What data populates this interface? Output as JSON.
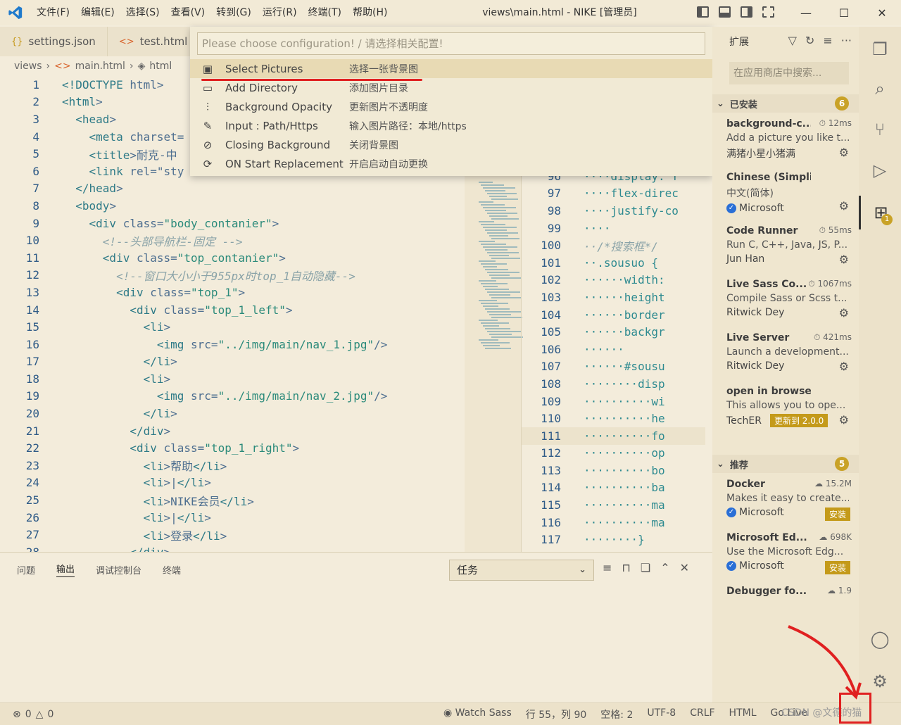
{
  "titlebar": {
    "menu": [
      "文件(F)",
      "编辑(E)",
      "选择(S)",
      "查看(V)",
      "转到(G)",
      "运行(R)",
      "终端(T)",
      "帮助(H)"
    ],
    "title": "views\\main.html - NIKE [管理员]",
    "controls": [
      "—",
      "☐",
      "✕"
    ]
  },
  "tabs": [
    {
      "icon": "{}",
      "label": "settings.json"
    },
    {
      "icon": "<>",
      "label": "test.html"
    }
  ],
  "breadcrumb": [
    "views",
    "main.html",
    "html"
  ],
  "quickpick": {
    "placeholder": "Please choose configuration! / 请选择相关配置!",
    "items": [
      {
        "label": "Select Pictures",
        "desc": "选择一张背景图",
        "icon": "image-icon"
      },
      {
        "label": "Add Directory",
        "desc": "添加图片目录",
        "icon": "folder-icon"
      },
      {
        "label": "Background Opacity",
        "desc": "更新图片不透明度",
        "icon": "sliders-icon"
      },
      {
        "label": "Input : Path/Https",
        "desc": "输入图片路径：本地/https",
        "icon": "pencil-icon"
      },
      {
        "label": "Closing Background",
        "desc": "关闭背景图",
        "icon": "eye-off-icon"
      },
      {
        "label": "ON Start Replacement",
        "desc": "开启启动自动更换",
        "icon": "refresh-icon"
      }
    ]
  },
  "editor_lines": [
    {
      "n": "1",
      "code": "<!DOCTYPE html>"
    },
    {
      "n": "2",
      "code": "<html>"
    },
    {
      "n": "3",
      "code": "  <head>"
    },
    {
      "n": "4",
      "code": "    <meta charset="
    },
    {
      "n": "5",
      "code": "    <title>耐克-中"
    },
    {
      "n": "6",
      "code": "    <link rel=\"sty"
    },
    {
      "n": "7",
      "code": "  </head>"
    },
    {
      "n": "8",
      "code": "  <body>"
    },
    {
      "n": "9",
      "code": "    <div class=\"body_contanier\">"
    },
    {
      "n": "10",
      "code": "      <!--头部导航栏-固定 -->"
    },
    {
      "n": "11",
      "code": "      <div class=\"top_contanier\">"
    },
    {
      "n": "12",
      "code": "        <!--窗口大小小于955px时top_1自动隐藏-->"
    },
    {
      "n": "13",
      "code": "        <div class=\"top_1\">"
    },
    {
      "n": "14",
      "code": "          <div class=\"top_1_left\">"
    },
    {
      "n": "15",
      "code": "            <li>"
    },
    {
      "n": "16",
      "code": "              <img src=\"../img/main/nav_1.jpg\"/>"
    },
    {
      "n": "17",
      "code": "            </li>"
    },
    {
      "n": "18",
      "code": "            <li>"
    },
    {
      "n": "19",
      "code": "              <img src=\"../img/main/nav_2.jpg\"/>"
    },
    {
      "n": "20",
      "code": "            </li>"
    },
    {
      "n": "21",
      "code": "          </div>"
    },
    {
      "n": "22",
      "code": "          <div class=\"top_1_right\">"
    },
    {
      "n": "23",
      "code": "            <li>帮助</li>"
    },
    {
      "n": "24",
      "code": "            <li>|</li>"
    },
    {
      "n": "25",
      "code": "            <li>NIKE会员</li>"
    },
    {
      "n": "26",
      "code": "            <li>|</li>"
    },
    {
      "n": "27",
      "code": "            <li>登录</li>"
    },
    {
      "n": "28",
      "code": "          </div>"
    }
  ],
  "editor2_lines": [
    {
      "n": "96",
      "code": "····display: f"
    },
    {
      "n": "97",
      "code": "····flex-direc"
    },
    {
      "n": "98",
      "code": "····justify-co"
    },
    {
      "n": "99",
      "code": "····"
    },
    {
      "n": "100",
      "code": "··/*搜索框*/"
    },
    {
      "n": "101",
      "code": "··.sousuo {"
    },
    {
      "n": "102",
      "code": "······width:"
    },
    {
      "n": "103",
      "code": "······height"
    },
    {
      "n": "104",
      "code": "······border"
    },
    {
      "n": "105",
      "code": "······backgr"
    },
    {
      "n": "106",
      "code": "······"
    },
    {
      "n": "107",
      "code": "······#sousu"
    },
    {
      "n": "108",
      "code": "········disp"
    },
    {
      "n": "109",
      "code": "··········wi"
    },
    {
      "n": "110",
      "code": "··········he"
    },
    {
      "n": "111",
      "code": "··········fo"
    },
    {
      "n": "112",
      "code": "··········op"
    },
    {
      "n": "113",
      "code": "··········bo"
    },
    {
      "n": "114",
      "code": "··········ba"
    },
    {
      "n": "115",
      "code": "··········ma"
    },
    {
      "n": "116",
      "code": "··········ma"
    },
    {
      "n": "117",
      "code": "········}"
    }
  ],
  "sidebar": {
    "title": "扩展",
    "search_placeholder": "在应用商店中搜索...",
    "installed_label": "已安装",
    "installed_count": "6",
    "installed": [
      {
        "name": "background-c...",
        "meta": "12ms",
        "desc": "Add a picture you like t...",
        "pub": "满猪小星小猪满",
        "verified": false
      },
      {
        "name": "Chinese (Simplified) (...",
        "meta": "",
        "desc": "中文(简体)",
        "pub": "Microsoft",
        "verified": true
      },
      {
        "name": "Code Runner",
        "meta": "55ms",
        "desc": "Run C, C++, Java, JS, P...",
        "pub": "Jun Han",
        "verified": false
      },
      {
        "name": "Live Sass Co...",
        "meta": "1067ms",
        "desc": "Compile Sass or Scss t...",
        "pub": "Ritwick Dey",
        "verified": false
      },
      {
        "name": "Live Server",
        "meta": "421ms",
        "desc": "Launch a development...",
        "pub": "Ritwick Dey",
        "verified": false
      },
      {
        "name": "open in browser",
        "meta": "",
        "desc": "This allows you to ope...",
        "pub": "TechER",
        "verified": false,
        "update": "更新到 2.0.0"
      }
    ],
    "recommended_label": "推荐",
    "recommended_count": "5",
    "recommended": [
      {
        "name": "Docker",
        "meta": "15.2M",
        "desc": "Makes it easy to create...",
        "pub": "Microsoft",
        "install": "安装"
      },
      {
        "name": "Microsoft Ed...",
        "meta": "698K",
        "desc": "Use the Microsoft Edg...",
        "pub": "Microsoft",
        "install": "安装"
      },
      {
        "name": "Debugger fo...",
        "meta": "1.9",
        "desc": "",
        "pub": "",
        "install": ""
      }
    ]
  },
  "panel": {
    "tabs": [
      "问题",
      "输出",
      "调试控制台",
      "终端"
    ],
    "select": "任务"
  },
  "statusbar": {
    "errors": "0",
    "warnings": "0",
    "items": [
      "Watch Sass",
      "行 55，列 90",
      "空格: 2",
      "UTF-8",
      "CRLF",
      "HTML",
      "Go Live"
    ],
    "watermark": "CSDN @文德的猫"
  },
  "colors": {
    "accent": "#c9a227",
    "highlight_red": "#e02020",
    "background": "#f3ecdb"
  }
}
